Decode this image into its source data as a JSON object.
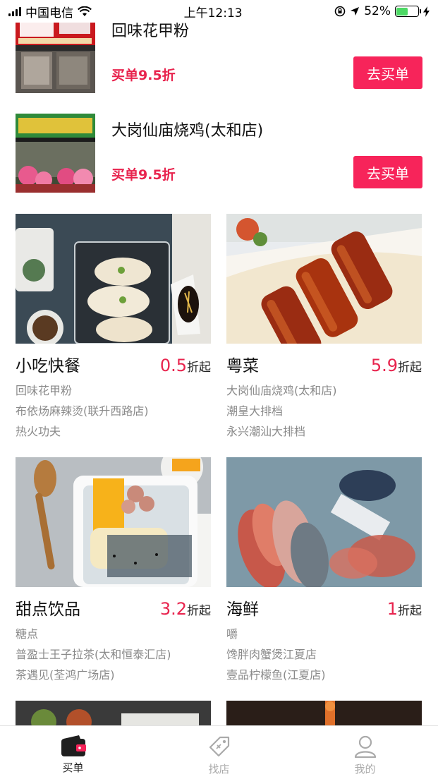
{
  "status_bar": {
    "carrier": "中国电信",
    "time": "上午12:13",
    "battery": "52%"
  },
  "stores": [
    {
      "name": "回味花甲粉",
      "discount": "买单9.5折",
      "button": "去买单"
    },
    {
      "name": "大岗仙庙烧鸡(太和店)",
      "discount": "买单9.5折",
      "button": "去买单"
    }
  ],
  "categories": [
    {
      "title": "小吃快餐",
      "rate_value": "0.5",
      "rate_suffix": "折起",
      "shops": [
        "回味花甲粉",
        "布依炀麻辣烫(联升西路店)",
        "热火功夫"
      ]
    },
    {
      "title": "粤菜",
      "rate_value": "5.9",
      "rate_suffix": "折起",
      "shops": [
        "大岗仙庙烧鸡(太和店)",
        "潮皇大排档",
        "永兴潮汕大排档"
      ]
    },
    {
      "title": "甜点饮品",
      "rate_value": "3.2",
      "rate_suffix": "折起",
      "shops": [
        "糖点",
        "普盈士王子拉茶(太和恒泰汇店)",
        "茶遇见(荃鸿广场店)"
      ]
    },
    {
      "title": "海鲜",
      "rate_value": "1",
      "rate_suffix": "折起",
      "shops": [
        "嚼",
        "馋胖肉蟹煲江夏店",
        "壹品柠檬鱼(江夏店)"
      ]
    }
  ],
  "tabs": [
    {
      "label": "买单",
      "icon": "wallet-icon",
      "active": true
    },
    {
      "label": "找店",
      "icon": "tag-icon",
      "active": false
    },
    {
      "label": "我的",
      "icon": "user-icon",
      "active": false
    }
  ],
  "colors": {
    "accent": "#f7245a",
    "discount_text": "#e8244e",
    "muted_text": "#8a8a8a"
  }
}
